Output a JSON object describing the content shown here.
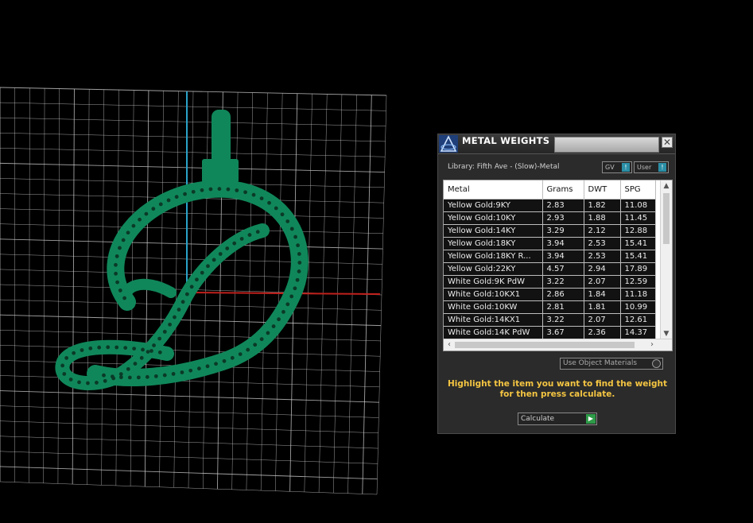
{
  "panel": {
    "title": "METAL WEIGHTS",
    "close_glyph": "✕",
    "library_label": "Library: Fifth Ave - (Slow)-Metal",
    "gv_dropdown": "GV",
    "user_dropdown": "User",
    "use_object_materials": "Use Object Materials",
    "hint_line1": "Highlight the item you want to find the weight",
    "hint_line2": "for then press calculate.",
    "calculate_label": "Calculate",
    "accent_color": "#f4c542",
    "go_color": "#2e9b48",
    "dropdown_accent": "#2b8fa6"
  },
  "table": {
    "columns": [
      "Metal",
      "Grams",
      "DWT",
      "SPG"
    ],
    "rows": [
      {
        "metal": "Yellow Gold:9KY",
        "grams": "2.83",
        "dwt": "1.82",
        "spg": "11.08"
      },
      {
        "metal": "Yellow Gold:10KY",
        "grams": "2.93",
        "dwt": "1.88",
        "spg": "11.45"
      },
      {
        "metal": "Yellow Gold:14KY",
        "grams": "3.29",
        "dwt": "2.12",
        "spg": "12.88"
      },
      {
        "metal": "Yellow Gold:18KY",
        "grams": "3.94",
        "dwt": "2.53",
        "spg": "15.41"
      },
      {
        "metal": "Yellow Gold:18KY R...",
        "grams": "3.94",
        "dwt": "2.53",
        "spg": "15.41"
      },
      {
        "metal": "Yellow Gold:22KY",
        "grams": "4.57",
        "dwt": "2.94",
        "spg": "17.89"
      },
      {
        "metal": "White Gold:9K PdW",
        "grams": "3.22",
        "dwt": "2.07",
        "spg": "12.59"
      },
      {
        "metal": "White Gold:10KX1",
        "grams": "2.86",
        "dwt": "1.84",
        "spg": "11.18"
      },
      {
        "metal": "White Gold:10KW",
        "grams": "2.81",
        "dwt": "1.81",
        "spg": "10.99"
      },
      {
        "metal": "White Gold:14KX1",
        "grams": "3.22",
        "dwt": "2.07",
        "spg": "12.61"
      },
      {
        "metal": "White Gold:14K PdW",
        "grams": "3.67",
        "dwt": "2.36",
        "spg": "14.37"
      }
    ]
  },
  "viewport": {
    "background": "#000000",
    "grid_color": "#d6d6d6",
    "model_color": "#10875a",
    "axis_y_color": "#2aa3c9",
    "axis_x_color": "#c0201c"
  }
}
